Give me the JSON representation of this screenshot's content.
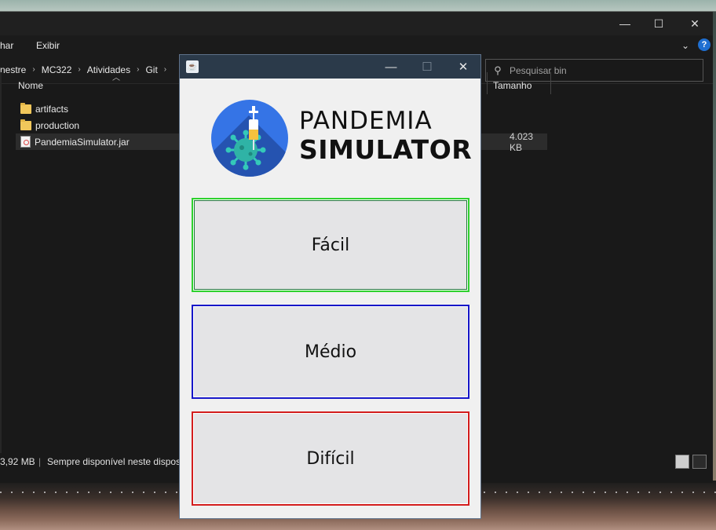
{
  "explorer": {
    "menu": [
      "har",
      "Exibir"
    ],
    "breadcrumb": [
      "nestre",
      "MC322",
      "Atividades",
      "Git"
    ],
    "search_placeholder": "Pesquisar bin",
    "columns": {
      "name": "Nome",
      "size": "Tamanho"
    },
    "files": [
      {
        "name": "artifacts",
        "type": "folder",
        "size": ""
      },
      {
        "name": "production",
        "type": "folder",
        "size": ""
      },
      {
        "name": "PandemiaSimulator.jar",
        "type": "jar",
        "size": "4.023 KB"
      }
    ],
    "status": {
      "size": "3,92 MB",
      "availability": "Sempre disponível neste disposi"
    },
    "help": "?"
  },
  "dialog": {
    "logo": {
      "line1": "PANDEMIA",
      "line2": "SIMULATOR"
    },
    "buttons": {
      "easy": "Fácil",
      "medium": "Médio",
      "hard": "Difícil"
    },
    "colors": {
      "easy": "#2ed12e",
      "medium": "#1717c8",
      "hard": "#d31d1d"
    }
  }
}
